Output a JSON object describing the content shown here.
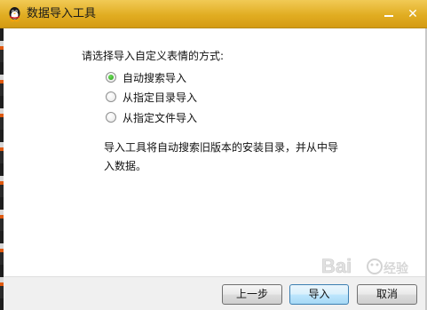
{
  "window": {
    "title": "数据导入工具",
    "minimize_icon": "minimize-icon",
    "close_icon": "close-icon",
    "close_glyph": "✕",
    "app_icon": "qq-penguin-icon"
  },
  "main": {
    "prompt": "请选择导入自定义表情的方式:",
    "options": [
      {
        "label": "自动搜索导入",
        "selected": true
      },
      {
        "label": "从指定目录导入",
        "selected": false
      },
      {
        "label": "从指定文件导入",
        "selected": false
      }
    ],
    "description": "导入工具将自动搜索旧版本的安装目录，并从中导入数据。"
  },
  "buttons": {
    "prev_label": "上一步",
    "import_label": "导入",
    "cancel_label": "取消"
  },
  "colors": {
    "titlebar": "#e1ad22",
    "radio_selected": "#2a9a1c",
    "default_button_border": "#3c7fb1"
  }
}
